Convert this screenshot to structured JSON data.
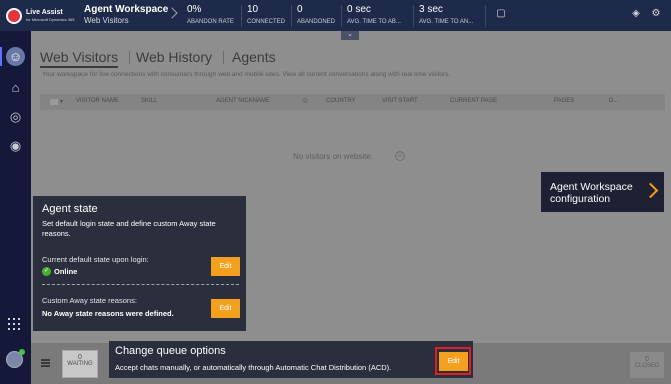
{
  "app": {
    "logo_name": "Live Assist",
    "logo_sub": "for Microsoft Dynamics 365",
    "workspace_title": "Agent Workspace",
    "workspace_sub": "Web Visitors"
  },
  "stats": [
    {
      "value": "0%",
      "label": "ABANDON RATE"
    },
    {
      "value": "10",
      "label": "CONNECTED"
    },
    {
      "value": "0",
      "label": "ABANDONED"
    },
    {
      "value": "0 sec",
      "label": "AVG. TIME TO AB..."
    },
    {
      "value": "3 sec",
      "label": "AVG. TIME TO AN..."
    }
  ],
  "tabs": {
    "active": "Web Visitors",
    "history": "Web History",
    "agents": "Agents"
  },
  "description": "Your workspace for live connections with consumers through web and mobile sites. View all current conversations along with real time visitors.",
  "table": {
    "columns": [
      "VISITOR NAME",
      "SKILL",
      "AGENT NICKNAME",
      "COUNTRY",
      "VISIT START",
      "CURRENT PAGE",
      "PAGES",
      "D..."
    ],
    "empty_message": "No visitors on website."
  },
  "agent_workspace_card": {
    "title": "Agent Workspace configuration"
  },
  "agent_state_card": {
    "title": "Agent state",
    "description": "Set default login state and define custom Away state reasons.",
    "default_label": "Current default state upon login:",
    "default_value": "Online",
    "away_label": "Custom Away state reasons:",
    "away_value": "No Away state reasons were defined.",
    "edit_label": "Edit"
  },
  "queue_card": {
    "title": "Change queue options",
    "description": "Accept chats manually, or automatically through Automatic Chat Distribution (ACD).",
    "edit_label": "Edit"
  },
  "bottom": {
    "waiting_count": "0",
    "waiting_label": "WAITING",
    "closed_count": "0",
    "closed_label": "CLOSED"
  },
  "colors": {
    "topbar": "#1e2a4a",
    "sidebar": "#14193a",
    "accent": "#f2a01e",
    "highlight": "#e02020",
    "online": "#46b232"
  }
}
